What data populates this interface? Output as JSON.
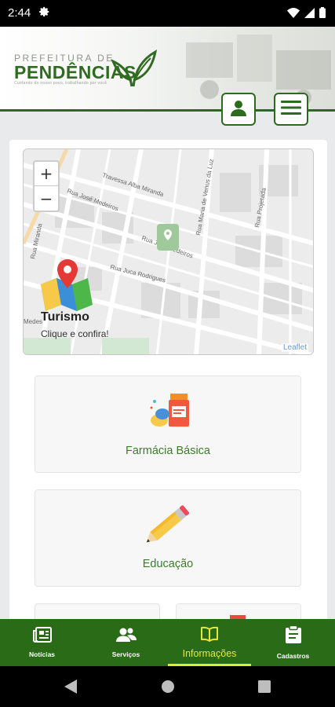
{
  "status": {
    "time": "2:44"
  },
  "header": {
    "logo_top": "PREFEITURA DE",
    "logo_main": "PENDÊNCIAS",
    "logo_tagline": "Cuidando do nosso povo, trabalhando por você"
  },
  "map": {
    "zoom_in": "+",
    "zoom_out": "−",
    "attribution": "Leaflet",
    "streets": [
      "Travessa Alba Miranda",
      "Rua José Medeiros",
      "Rua José Medeiros",
      "Rua Juca Rodrigues",
      "Rua Maria de Venus da Luz",
      "Rua Projetada",
      "Rua Miranda",
      "Medes"
    ],
    "title": "Turismo",
    "subtitle": "Clique e confira!"
  },
  "services": [
    {
      "label": "Farmácia Básica",
      "icon": "pharmacy-icon"
    },
    {
      "label": "Educação",
      "icon": "pencil-icon"
    }
  ],
  "bottom_nav": [
    {
      "label": "Notícias",
      "icon": "newspaper-icon",
      "active": false
    },
    {
      "label": "Serviços",
      "icon": "people-icon",
      "active": false
    },
    {
      "label": "Informações",
      "icon": "book-icon",
      "active": true
    },
    {
      "label": "Cadastros",
      "icon": "clipboard-icon",
      "active": false
    }
  ],
  "colors": {
    "brand_green": "#2a6b18",
    "active_yellow": "#e4e83a",
    "label_green": "#3f7a2e"
  }
}
